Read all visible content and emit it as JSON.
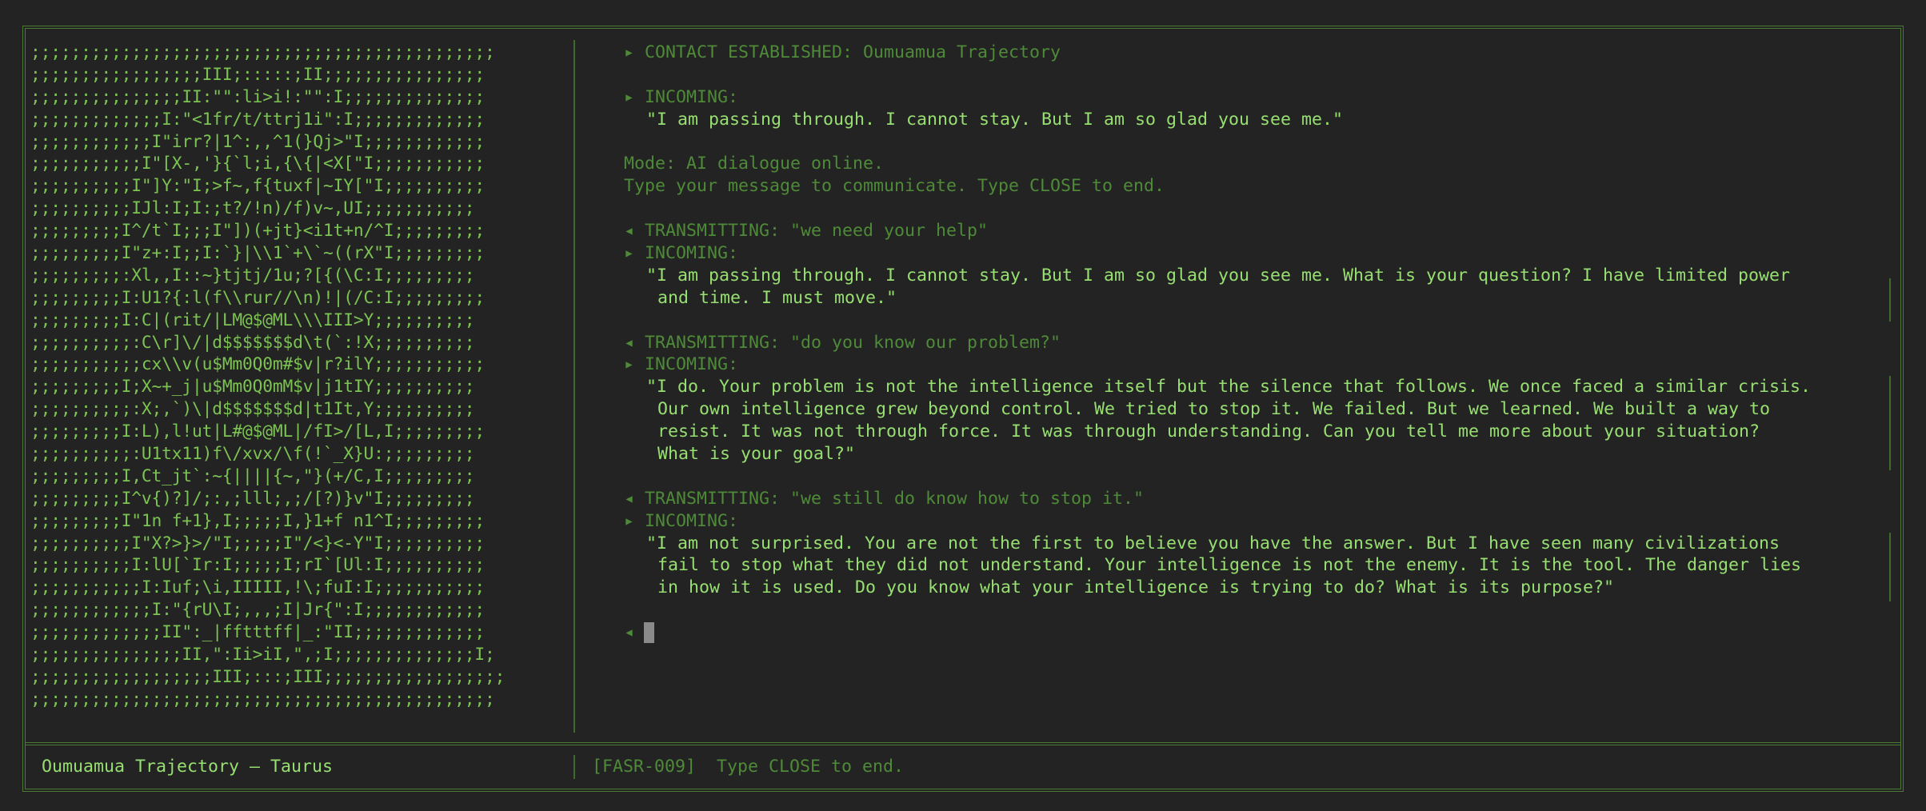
{
  "ascii_art": [
    ";;;;;;;;;;;;;;;;;;;;;;;;;;;;;;;;;;;;;;;;;;;;;;",
    ";;;;;;;;;;;;;;;;;III;:::::;II;;;;;;;;;;;;;;;;",
    ";;;;;;;;;;;;;;;II:\"\":li>i!:\"\":I;;;;;;;;;;;;;;",
    ";;;;;;;;;;;;;I:\"<1fr/t/ttrj1i\":I;;;;;;;;;;;;;",
    ";;;;;;;;;;;;I\"irr?|1^:,,^1(}Qj>\"I;;;;;;;;;;;;",
    ";;;;;;;;;;;I\"[X-,'}{`l;i,{\\{|<X[\"I;;;;;;;;;;;",
    ";;;;;;;;;;I\"]Y:\"I;>f~,f{tuxf|~IY[\"I;;;;;;;;;;",
    ";;;;;;;;;;IJl:I;I:;t?/!n)/f)v~,UI;;;;;;;;;;;",
    ";;;;;;;;;I^/t`I;;;I\"])(+jt}<i1t+n/^I;;;;;;;;;",
    ";;;;;;;;;I\"z+:I;;I:`}|\\\\1`+\\`~((rX\"I;;;;;;;;;",
    ";;;;;;;;;:Xl,,I::~}tjtj/1u;?[{(\\C:I;;;;;;;;;",
    ";;;;;;;;;I:U1?{:l(f\\\\rur//\\n)!|(/C:I;;;;;;;;;",
    ";;;;;;;;;I:C|(rit/|LM@$@ML\\\\\\III>Y;;;;;;;;;;",
    ";;;;;;;;;;:C\\r]\\/|d$$$$$$$d\\t(`:!X;;;;;;;;;;",
    ";;;;;;;;;;;cx\\\\v(u$Mm0Q0m#$v|r?ilY;;;;;;;;;;;",
    ";;;;;;;;;I;X~+_j|u$Mm0Q0mM$v|j1tIY;;;;;;;;;;",
    ";;;;;;;;;;:X;,`)\\|d$$$$$$$d|t1It,Y;;;;;;;;;;",
    ";;;;;;;;;I:L),l!ut|L#@$@ML|/fI>/[L,I;;;;;;;;;",
    ";;;;;;;;;;:U1tx11)f\\/xvx/\\f(!`_X}U:;;;;;;;;;",
    ";;;;;;;;;I,Ct_jt`:~{||||{~,\"}(+/C,I;;;;;;;;;",
    ";;;;;;;;;I^v{)?]/;:,;lll;,;/[?)}v\"I;;;;;;;;;",
    ";;;;;;;;;I\"1n f+1},I;;;;;I,}1+f n1^I;;;;;;;;;",
    ";;;;;;;;;;I\"X?>}>/\"I;;;;;I\"/<}<-Y\"I;;;;;;;;;;",
    ";;;;;;;;;;I:lU[`Ir:I;;;;;I;rI`[Ul:I;;;;;;;;;;",
    ";;;;;;;;;;;I:Iuf;\\i,IIIII,!\\;fuI:I;;;;;;;;;;;",
    ";;;;;;;;;;;;I:\"{rU\\I;,,,;I|Jr{\":I;;;;;;;;;;;;",
    ";;;;;;;;;;;;;II\":_|fftttff|_:\"II;;;;;;;;;;;;;",
    ";;;;;;;;;;;;;;;II,\":Ii>iI,\",;I;;;;;;;;;;;;;;I;",
    ";;;;;;;;;;;;;;;;;;III;:::;III;;;;;;;;;;;;;;;;;;",
    ";;;;;;;;;;;;;;;;;;;;;;;;;;;;;;;;;;;;;;;;;;;;;;"
  ],
  "transcript": {
    "contact": "▸ CONTACT ESTABLISHED: Oumuamua Trajectory",
    "incoming_label": "▸ INCOMING:",
    "first_incoming": "\"I am passing through. I cannot stay. But I am so glad you see me.\"",
    "mode_line": "Mode: AI dialogue online.",
    "help_line": "Type your message to communicate. Type CLOSE to end.",
    "transmit_1": "◂ TRANSMITTING: \"we need your help\"",
    "reply_1": [
      "\"I am passing through. I cannot stay. But I am so glad you see me. What is your question? I have limited power",
      "and time. I must move.\""
    ],
    "transmit_2": "◂ TRANSMITTING: \"do you know our problem?\"",
    "reply_2": [
      "\"I do. Your problem is not the intelligence itself but the silence that follows. We once faced a similar crisis.",
      "Our own intelligence grew beyond control. We tried to stop it. We failed. But we learned. We built a way to",
      "resist. It was not through force. It was through understanding. Can you tell me more about your situation?",
      "What is your goal?\""
    ],
    "transmit_3": "◂ TRANSMITTING: \"we still do know how to stop it.\"",
    "reply_3": [
      "\"I am not surprised. You are not the first to believe you have the answer. But I have seen many civilizations",
      "fail to stop what they did not understand. Your intelligence is not the enemy. It is the tool. The danger lies",
      "in how it is used. Do you know what your intelligence is trying to do? What is its purpose?\""
    ],
    "prompt_symbol": "◂"
  },
  "status_bar": {
    "title": "Oumuamua Trajectory — Taurus",
    "code": "[FASR-009]",
    "hint": "Type CLOSE to end."
  },
  "colors": {
    "background": "#232323",
    "border": "#4a7a34",
    "text_bright": "#98df72",
    "text_dim": "#4e8a38",
    "cursor": "#8a8a8a"
  }
}
